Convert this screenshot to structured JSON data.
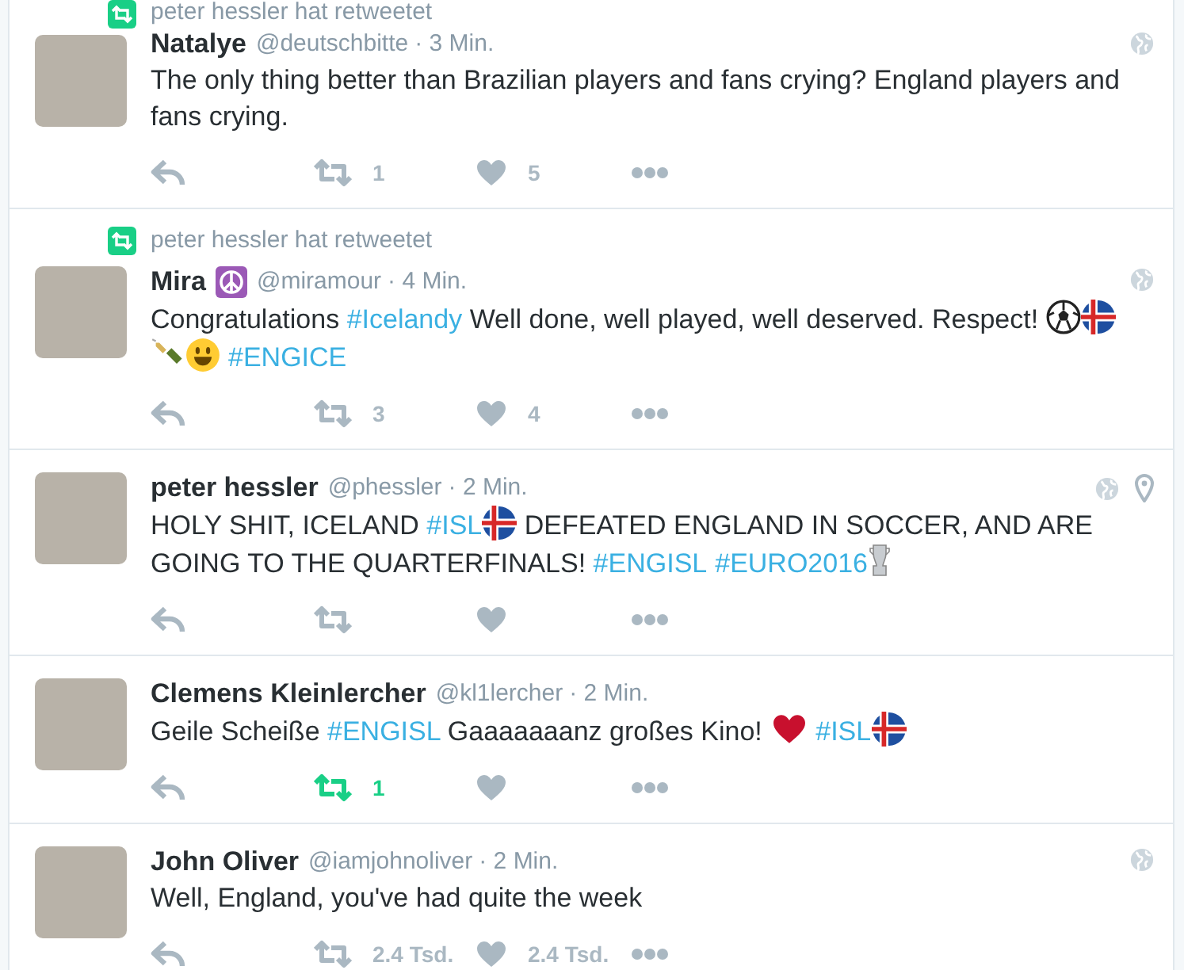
{
  "tweets": [
    {
      "context": "peter hessler hat retweetet",
      "name": "Natalye",
      "handle": "@deutschbitte",
      "time": "· 3 Min.",
      "globe": true,
      "location": false,
      "text": [
        {
          "kind": "text",
          "text": "The only thing better than Brazilian players and fans crying? England players and fans crying."
        }
      ],
      "retweet_count": "1",
      "retweeted": false,
      "like_count": "5",
      "liked": false
    },
    {
      "context": "peter hessler hat retweetet",
      "name": "Mira",
      "badge": {
        "kind": "peace"
      },
      "handle": "@miramour",
      "time": "· 4 Min.",
      "globe": true,
      "location": false,
      "text": [
        {
          "kind": "text",
          "text": "Congratulations "
        },
        {
          "kind": "hashtag",
          "text": "#Icelandy"
        },
        {
          "kind": "text",
          "text": " Well done, well played, well deserved. Respect! "
        },
        {
          "kind": "ball"
        },
        {
          "kind": "flag"
        },
        {
          "kind": "bottle"
        },
        {
          "kind": "smiley"
        },
        {
          "kind": "hashtag",
          "text": "#ENGICE"
        }
      ],
      "retweet_count": "3",
      "retweeted": false,
      "like_count": "4",
      "liked": false
    },
    {
      "name": "peter hessler",
      "handle": "@phessler",
      "time": "· 2 Min.",
      "globe": true,
      "location": true,
      "text": [
        {
          "kind": "text",
          "text": "HOLY SHIT, ICELAND "
        },
        {
          "kind": "hashtag",
          "text": "#ISL"
        },
        {
          "kind": "flag"
        },
        {
          "kind": "text",
          "text": " DEFEATED ENGLAND IN SOCCER, AND ARE GOING TO THE QUARTERFINALS! "
        },
        {
          "kind": "hashtag",
          "text": "#ENGISL"
        },
        {
          "kind": "hashtag",
          "text": "#EURO2016"
        },
        {
          "kind": "trophy"
        }
      ],
      "retweeted": false,
      "liked": false
    },
    {
      "name": "Clemens Kleinlercher",
      "handle": "@kl1lercher",
      "time": "· 2 Min.",
      "globe": false,
      "location": false,
      "text": [
        {
          "kind": "text",
          "text": "Geile Scheiße "
        },
        {
          "kind": "hashtag",
          "text": "#ENGISL"
        },
        {
          "kind": "text",
          "text": " Gaaaaaaanz großes Kino! "
        },
        {
          "kind": "heart"
        },
        {
          "kind": "hashtag",
          "text": "#ISL"
        },
        {
          "kind": "flag"
        }
      ],
      "retweet_count": "1",
      "retweeted": true,
      "liked": false
    },
    {
      "name": "John Oliver",
      "handle": "@iamjohnoliver",
      "time": "· 2 Min.",
      "globe": true,
      "location": false,
      "text": [
        {
          "kind": "text",
          "text": "Well, England, you've had quite the week"
        }
      ],
      "retweet_count": "2.4 Tsd.",
      "retweeted": false,
      "like_count": "2.4 Tsd.",
      "liked": false
    }
  ]
}
